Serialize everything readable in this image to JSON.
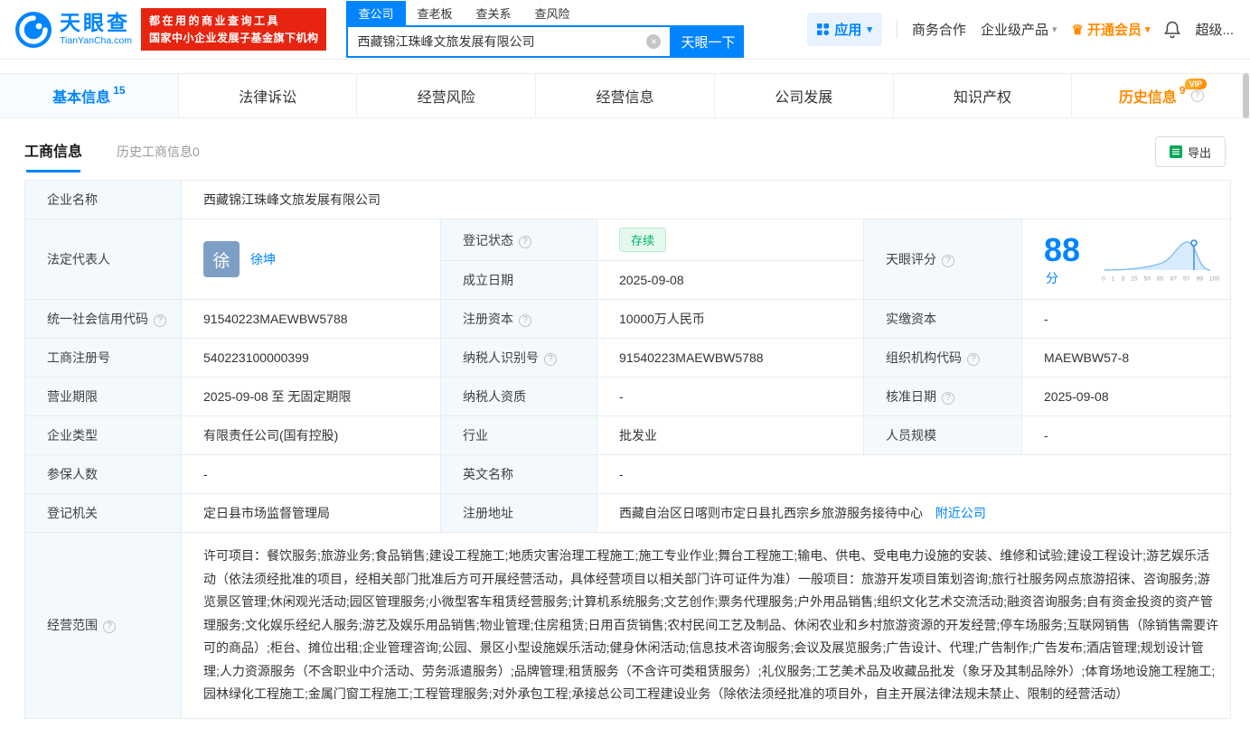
{
  "colors": {
    "brand_blue": "#0084ff",
    "vip_orange": "#ff8a00",
    "logo_red": "#e72410",
    "status_green": "#00b365",
    "label_cell_bg": "#f3f9fc"
  },
  "icons": {
    "help_glyph": "?",
    "clear_glyph": "×",
    "caret_glyph": "▾",
    "crown_glyph": "♛"
  },
  "header": {
    "brand": {
      "name": "天眼查",
      "domain": "TianYanCha.com"
    },
    "slogan": {
      "line1": "都在用的商业查询工具",
      "line2": "国家中小企业发展子基金旗下机构"
    },
    "search_tabs": [
      {
        "label": "查公司"
      },
      {
        "label": "查老板"
      },
      {
        "label": "查关系"
      },
      {
        "label": "查风险"
      }
    ],
    "search": {
      "value": "西藏锦江珠峰文旅发展有限公司",
      "button_label": "天眼一下"
    },
    "apps_label": "应用",
    "links": {
      "cooperation": "商务合作",
      "enterprise": "企业级产品",
      "vip": "开通会员",
      "super": "超级..."
    }
  },
  "main_tabs": [
    {
      "label": "基本信息",
      "count": "15"
    },
    {
      "label": "法律诉讼",
      "count": ""
    },
    {
      "label": "经营风险",
      "count": ""
    },
    {
      "label": "经营信息",
      "count": ""
    },
    {
      "label": "公司发展",
      "count": ""
    },
    {
      "label": "知识产权",
      "count": ""
    },
    {
      "label": "历史信息",
      "count": "9",
      "vip_badge": "VIP"
    }
  ],
  "subtabs": {
    "current": "工商信息",
    "history": "历史工商信息",
    "history_count": "0"
  },
  "toolbar": {
    "export_label": "导出"
  },
  "score_chart": {
    "type": "area",
    "score": "88",
    "unit": "分",
    "ticks": [
      "0",
      "1",
      "3",
      "15",
      "50",
      "85",
      "87",
      "97",
      "99",
      "100"
    ]
  },
  "info": {
    "company_name": {
      "label": "企业名称",
      "value": "西藏锦江珠峰文旅发展有限公司"
    },
    "legal_rep": {
      "label": "法定代表人",
      "avatar": "徐",
      "value": "徐坤"
    },
    "reg_status": {
      "label": "登记状态",
      "value": "存续"
    },
    "establish_date": {
      "label": "成立日期",
      "value": "2025-09-08"
    },
    "score": {
      "label": "天眼评分"
    },
    "credit_code": {
      "label": "统一社会信用代码",
      "value": "91540223MAEWBW5788"
    },
    "reg_capital": {
      "label": "注册资本",
      "value": "10000万人民币"
    },
    "paid_capital": {
      "label": "实缴资本",
      "value": "-"
    },
    "reg_number": {
      "label": "工商注册号",
      "value": "540223100000399"
    },
    "taxpayer_id": {
      "label": "纳税人识别号",
      "value": "91540223MAEWBW5788"
    },
    "org_code": {
      "label": "组织机构代码",
      "value": "MAEWBW57-8"
    },
    "business_term": {
      "label": "营业期限",
      "value": "2025-09-08 至 无固定期限"
    },
    "taxpayer_quality": {
      "label": "纳税人资质",
      "value": "-"
    },
    "approval_date": {
      "label": "核准日期",
      "value": "2025-09-08"
    },
    "company_type": {
      "label": "企业类型",
      "value": "有限责任公司(国有控股)"
    },
    "industry": {
      "label": "行业",
      "value": "批发业"
    },
    "staff_size": {
      "label": "人员规模",
      "value": "-"
    },
    "insured_count": {
      "label": "参保人数",
      "value": "-"
    },
    "english_name": {
      "label": "英文名称",
      "value": "-"
    },
    "reg_authority": {
      "label": "登记机关",
      "value": "定日县市场监督管理局"
    },
    "reg_address": {
      "label": "注册地址",
      "value": "西藏自治区日喀则市定日县扎西宗乡旅游服务接待中心",
      "link": "附近公司"
    },
    "business_scope": {
      "label": "经营范围",
      "value": "许可项目：餐饮服务;旅游业务;食品销售;建设工程施工;地质灾害治理工程施工;施工专业作业;舞台工程施工;输电、供电、受电电力设施的安装、维修和试验;建设工程设计;游艺娱乐活动（依法须经批准的项目，经相关部门批准后方可开展经营活动，具体经营项目以相关部门许可证件为准）一般项目：旅游开发项目策划咨询;旅行社服务网点旅游招徕、咨询服务;游览景区管理;休闲观光活动;园区管理服务;小微型客车租赁经营服务;计算机系统服务;文艺创作;票务代理服务;户外用品销售;组织文化艺术交流活动;融资咨询服务;自有资金投资的资产管理服务;文化娱乐经纪人服务;游艺及娱乐用品销售;物业管理;住房租赁;日用百货销售;农村民间工艺及制品、休闲农业和乡村旅游资源的开发经营;停车场服务;互联网销售（除销售需要许可的商品）;柜台、摊位出租;企业管理咨询;公园、景区小型设施娱乐活动;健身休闲活动;信息技术咨询服务;会议及展览服务;广告设计、代理;广告制作;广告发布;酒店管理;规划设计管理;人力资源服务（不含职业中介活动、劳务派遣服务）;品牌管理;租赁服务（不含许可类租赁服务）;礼仪服务;工艺美术品及收藏品批发（象牙及其制品除外）;体育场地设施工程施工;园林绿化工程施工;金属门窗工程施工;工程管理服务;对外承包工程;承接总公司工程建设业务（除依法须经批准的项目外，自主开展法律法规未禁止、限制的经营活动）"
    }
  }
}
